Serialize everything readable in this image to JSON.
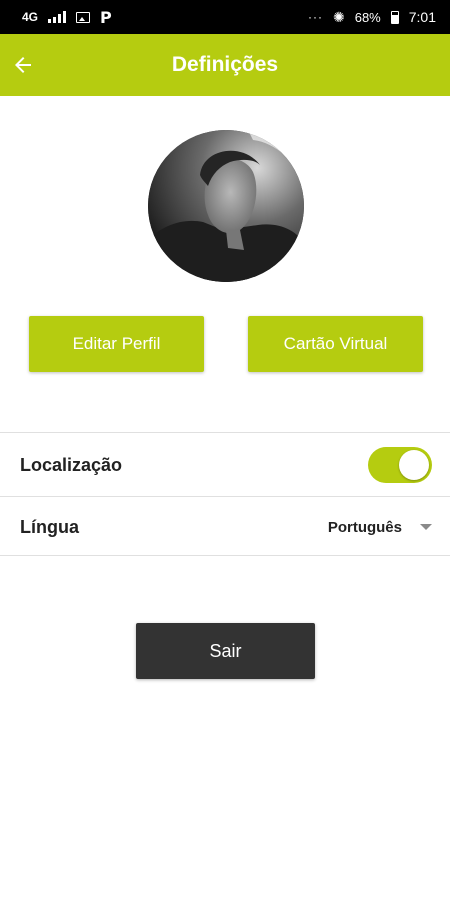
{
  "status_bar": {
    "network": "4G",
    "network_icon": "signal-icon",
    "image_icon": "image-icon",
    "app_icon_label": "P",
    "overflow": "···",
    "gear_icon": "gear-icon",
    "battery_percent": "68%",
    "time": "7:01"
  },
  "app_bar": {
    "back_icon": "arrow-left-icon",
    "title": "Definições",
    "color": "#b5cc10"
  },
  "profile": {
    "avatar_alt": "profile-photo"
  },
  "actions": {
    "edit_profile_label": "Editar Perfil",
    "virtual_card_label": "Cartão Virtual"
  },
  "settings": {
    "location_label": "Localização",
    "location_enabled": true,
    "language_label": "Língua",
    "language_value": "Português"
  },
  "exit_label": "Sair",
  "colors": {
    "accent": "#b5cc10",
    "exit_button": "#333333"
  }
}
